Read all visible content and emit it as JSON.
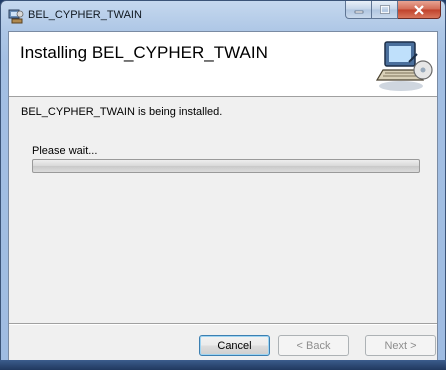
{
  "window": {
    "title": "BEL_CYPHER_TWAIN"
  },
  "header": {
    "title": "Installing BEL_CYPHER_TWAIN"
  },
  "main": {
    "status": "BEL_CYPHER_TWAIN is being installed.",
    "wait_label": "Please wait...",
    "progress_percent": 0
  },
  "buttons": {
    "cancel": "Cancel",
    "back": "< Back",
    "next": "Next >"
  },
  "icons": {
    "app": "installer-icon",
    "banner": "computer-install-icon"
  }
}
